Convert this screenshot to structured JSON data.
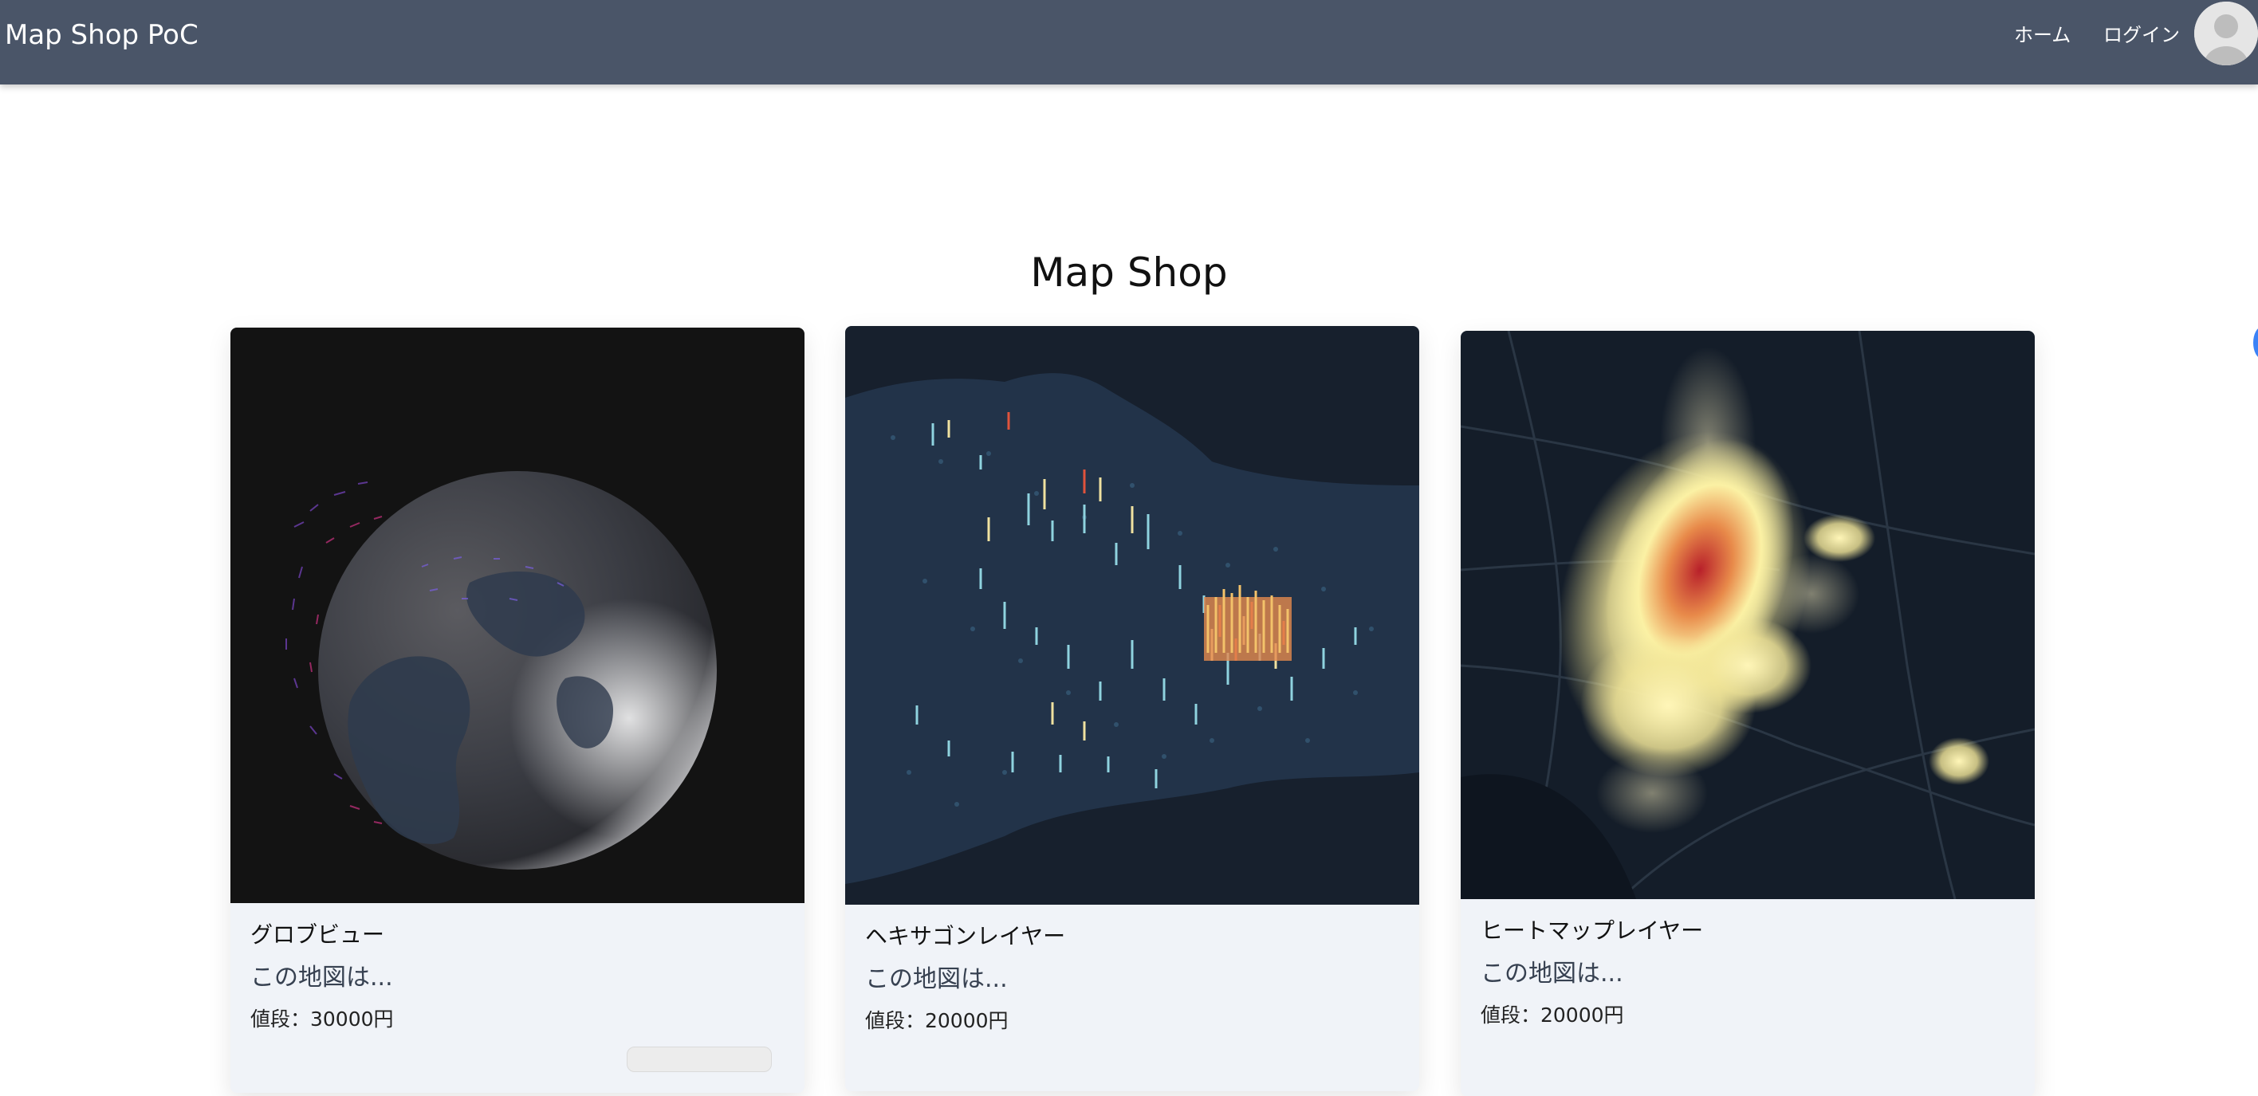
{
  "navbar": {
    "brand": "Map Shop PoC",
    "links": [
      "ホーム",
      "ログイン"
    ],
    "avatar_icon": "user-avatar-icon"
  },
  "page": {
    "title": "Map Shop"
  },
  "products": [
    {
      "name": "グロブビュー",
      "description": "この地図は...",
      "price": "値段：30000円",
      "image": "globe-view-image"
    },
    {
      "name": "ヘキサゴンレイヤー",
      "description": "この地図は...",
      "price": "値段：20000円",
      "image": "hexagon-layer-image"
    },
    {
      "name": "ヒートマップレイヤー",
      "description": "この地図は...",
      "price": "値段：20000円",
      "image": "heatmap-layer-image"
    }
  ],
  "colors": {
    "navbar": "#4a5568",
    "card_body": "#f0f3f8",
    "page_bg": "#ffffff"
  }
}
